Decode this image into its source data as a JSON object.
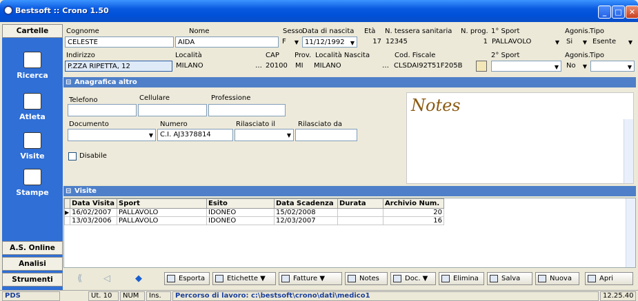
{
  "window": {
    "title": "Bestsoft :: Crono 1.50"
  },
  "sidebar": {
    "header": "Cartelle",
    "items": [
      {
        "label": "Ricerca",
        "icon": "people-icon"
      },
      {
        "label": "Atleta",
        "icon": "athlete-icon"
      },
      {
        "label": "Visite",
        "icon": "doctor-icon"
      },
      {
        "label": "Stampe",
        "icon": "print-doc-icon"
      }
    ],
    "bottom": [
      "A.S. Online",
      "Analisi",
      "Strumenti"
    ]
  },
  "form": {
    "cognome_label": "Cognome",
    "cognome": "CELESTE",
    "nome_label": "Nome",
    "nome": "AIDA",
    "sesso_label": "Sesso",
    "sesso": "F",
    "nascita_label": "Data di nascita",
    "nascita": "11/12/1992",
    "eta_label": "Età",
    "eta": "17",
    "tessera_label": "N. tessera sanitaria",
    "tessera": "12345",
    "nprog_label": "N. prog.",
    "nprog": "1",
    "sport1_label": "1° Sport",
    "sport1": "PALLAVOLO",
    "agonis_label": "Agonis.",
    "agonis1": "Si",
    "tipo_label": "Tipo",
    "tipo1": "Esente",
    "indirizzo_label": "Indirizzo",
    "indirizzo": "P.ZZA RIPETTA, 12",
    "localita_label": "Località",
    "localita": "MILANO",
    "cap_label": "CAP",
    "cap": "20100",
    "prov_label": "Prov.",
    "prov": "MI",
    "locnascita_label": "Località Nascita",
    "locnascita": "MILANO",
    "codfisc_label": "Cod. Fiscale",
    "codfisc": "CLSDAI92T51F205B",
    "sport2_label": "2° Sport",
    "sport2": "",
    "agonis2_label": "Agonis.",
    "agonis2": "No",
    "tipo2_label": "Tipo",
    "tipo2": ""
  },
  "anagrafica": {
    "title": "Anagrafica altro",
    "telefono_label": "Telefono",
    "telefono": "",
    "cellulare_label": "Cellulare",
    "cellulare": "",
    "professione_label": "Professione",
    "professione": "",
    "documento_label": "Documento",
    "documento": "",
    "numero_label": "Numero",
    "numero": "C.I. AJ3378814",
    "rilasciato_il_label": "Rilasciato il",
    "rilasciato_il": "",
    "rilasciato_da_label": "Rilasciato da",
    "rilasciato_da": "",
    "disabile_label": "Disabile",
    "notes_label": "Notes"
  },
  "visite": {
    "title": "Visite",
    "columns": [
      "Data Visita",
      "Sport",
      "Esito",
      "Data Scadenza",
      "Durata",
      "Archivio Num."
    ],
    "rows": [
      [
        "16/02/2007",
        "PALLAVOLO",
        "IDONEO",
        "15/02/2008",
        "",
        "20"
      ],
      [
        "13/03/2006",
        "PALLAVOLO",
        "IDONEO",
        "12/03/2007",
        "",
        "16"
      ]
    ]
  },
  "toolbar": {
    "esporta": "Esporta",
    "etichette": "Etichette",
    "fatture": "Fatture",
    "notes": "Notes",
    "doc": "Doc.",
    "elimina": "Elimina",
    "salva": "Salva",
    "nuova": "Nuova",
    "apri": "Apri"
  },
  "status": {
    "pds": "PDS",
    "ut": "Ut. 10",
    "num": "NUM",
    "ins": "Ins.",
    "percorso": "Percorso di lavoro: c:\\bestsoft\\crono\\dati\\medico1",
    "time": "12.25.40"
  }
}
